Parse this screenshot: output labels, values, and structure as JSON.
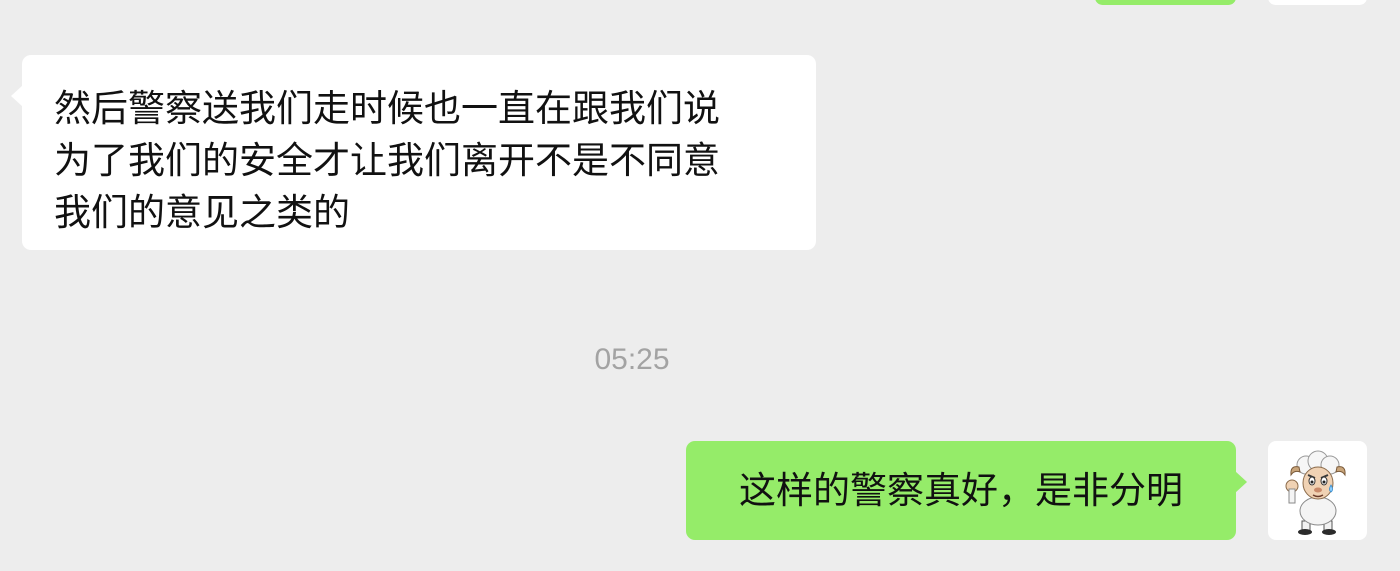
{
  "colors": {
    "background": "#ededed",
    "incoming_bubble": "#ffffff",
    "outgoing_bubble": "#95ec69",
    "timestamp_text": "#a3a3a3"
  },
  "messages": [
    {
      "side": "incoming",
      "text": "然后警察送我们走时候也一直在跟我们说\n为了我们的安全才让我们离开不是不同意\n我们的意见之类的"
    },
    {
      "side": "outgoing",
      "text": "这样的警察真好，是非分明",
      "avatar_icon": "cartoon-sheep-avatar-icon"
    }
  ],
  "timestamp": "05:25"
}
